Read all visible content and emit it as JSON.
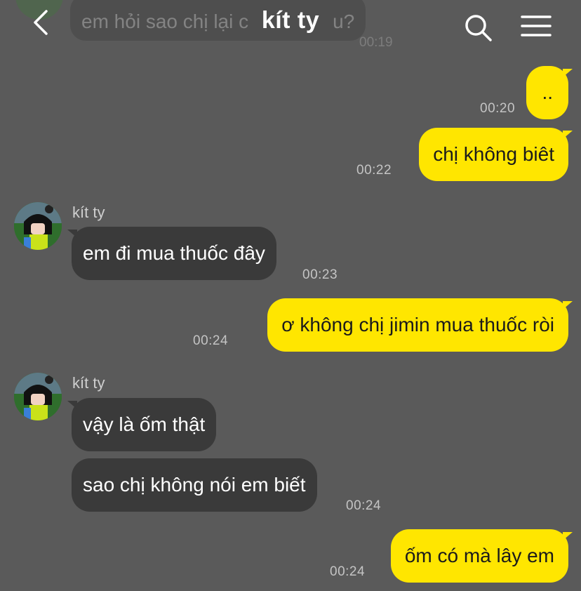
{
  "header": {
    "title": "kít ty",
    "back_icon": "chevron-left-icon",
    "search_icon": "search-icon",
    "menu_icon": "hamburger-menu-icon"
  },
  "peek": {
    "text": "em hỏi sao chị lại c",
    "text_end": "u?",
    "time": "00:19"
  },
  "colors": {
    "background": "#5a5a5a",
    "outgoing_bubble": "#ffe600",
    "incoming_bubble": "#3a3a3a"
  },
  "messages": [
    {
      "dir": "out",
      "text": "..",
      "time": "00:20"
    },
    {
      "dir": "out",
      "text": "chị không biêt",
      "time": "00:22"
    },
    {
      "dir": "in",
      "sender": "kít ty",
      "text": "em đi mua thuốc đây",
      "time": "00:23"
    },
    {
      "dir": "out",
      "text": "ơ không chị jimin mua thuốc ròi",
      "time": "00:24"
    },
    {
      "dir": "in",
      "sender": "kít ty",
      "text": "vậy là ốm thật",
      "time": ""
    },
    {
      "dir": "in",
      "text": "sao chị không nói em biết",
      "time": "00:24"
    },
    {
      "dir": "out",
      "text": "ốm có mà lây em",
      "time": "00:24"
    }
  ]
}
